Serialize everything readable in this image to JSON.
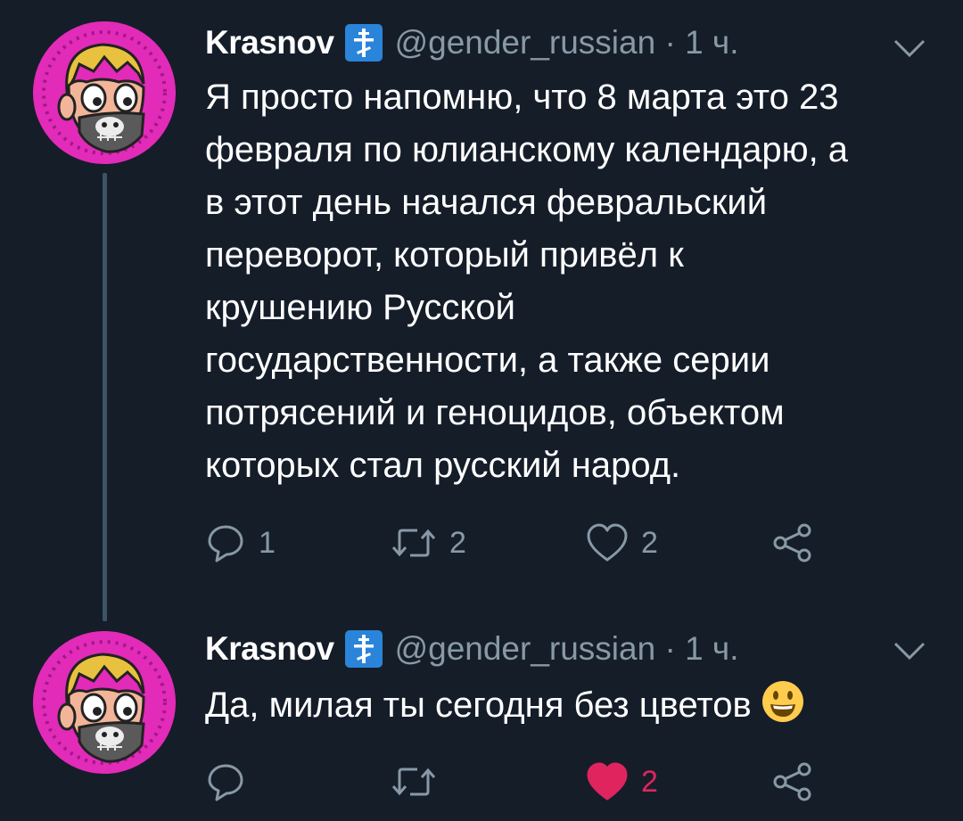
{
  "tweets": [
    {
      "author": {
        "display_name": "Krasnov",
        "badge_icon": "orthodox-cross-icon",
        "handle": "@gender_russian",
        "time": "1 ч."
      },
      "lines": [
        "Я просто напомню, что 8 марта это 23",
        "февраля по юлианскому календарю, а",
        "в этот день начался февральский",
        "переворот, который привёл к",
        "крушению Русской",
        "государственности, а также серии",
        "потрясений и геноцидов, объектом",
        "которых стал русский народ."
      ],
      "actions": {
        "replies": "1",
        "retweets": "2",
        "likes": "2",
        "liked": false
      }
    },
    {
      "author": {
        "display_name": "Krasnov",
        "badge_icon": "orthodox-cross-icon",
        "handle": "@gender_russian",
        "time": "1 ч."
      },
      "lines": [
        "Да, милая ты сегодня без цветов"
      ],
      "emoji": "smiley-face-icon",
      "actions": {
        "replies": "",
        "retweets": "",
        "likes": "2",
        "liked": true
      }
    }
  ],
  "colors": {
    "background": "#151d29",
    "text_primary": "#ffffff",
    "text_secondary": "#8899a6",
    "badge": "#2a84d9",
    "like_active": "#e0245e",
    "thread_line": "#3d5466",
    "avatar_bg": "#e22bb8"
  }
}
